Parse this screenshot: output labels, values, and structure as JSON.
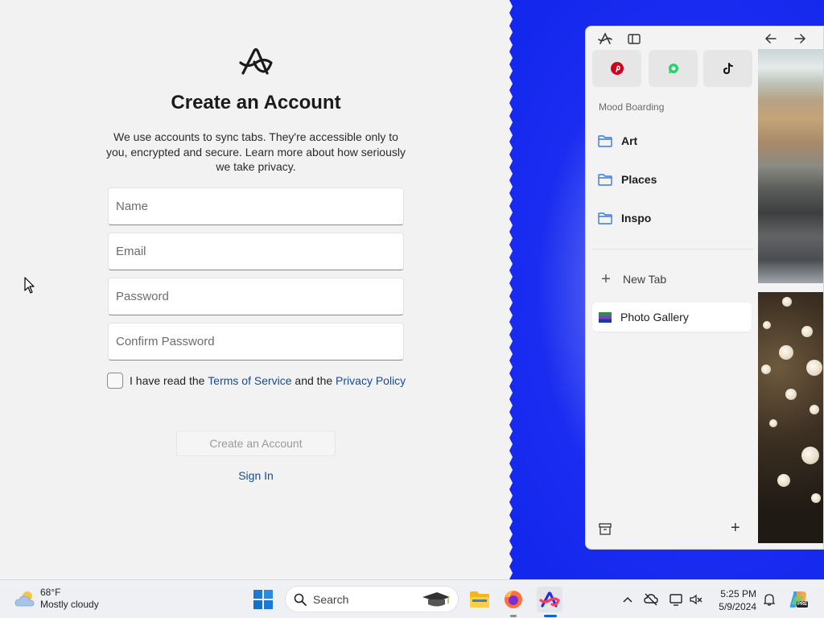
{
  "signup": {
    "title": "Create an Account",
    "description": "We use accounts to sync tabs. They're accessible only to you, encrypted and secure. Learn more about how seriously we take privacy.",
    "fields": {
      "name_placeholder": "Name",
      "email_placeholder": "Email",
      "password_placeholder": "Password",
      "confirm_placeholder": "Confirm Password"
    },
    "terms": {
      "prefix": "I have read the ",
      "tos_link": "Terms of Service",
      "middle": " and the ",
      "privacy_link": "Privacy Policy"
    },
    "create_button": "Create an Account",
    "signin_link": "Sign In"
  },
  "arc": {
    "favorites": [
      "pinterest-icon",
      "whatsapp-icon",
      "tiktok-icon"
    ],
    "space_label": "Mood Boarding",
    "folders": [
      "Art",
      "Places",
      "Inspo"
    ],
    "new_tab_label": "New Tab",
    "open_tab_label": "Photo Gallery"
  },
  "taskbar": {
    "weather_temp": "68°F",
    "weather_desc": "Mostly cloudy",
    "search_label": "Search",
    "time": "5:25 PM",
    "date": "5/9/2024"
  },
  "colors": {
    "link": "#144b94",
    "background_blue": "#1a2cf0"
  }
}
